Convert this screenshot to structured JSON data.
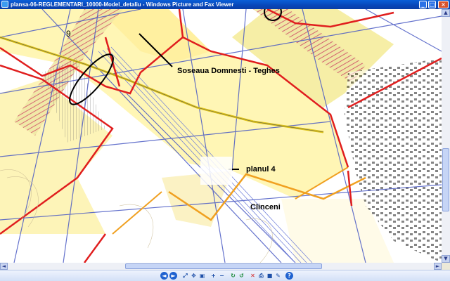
{
  "window": {
    "title": "plansa-06-REGLEMENTARI_10000-Model_detaliu - Windows Picture and Fax Viewer",
    "controls": {
      "minimize": "_",
      "maximize": "□",
      "close": "×"
    }
  },
  "map": {
    "labels": {
      "road": "Soseaua Domnesti - Teghes",
      "plan": "planul 4",
      "village": "Clinceni",
      "sheet_number": "9"
    },
    "colors": {
      "zone_fill": "#fff6b3",
      "boundary": "#e01e1e",
      "grid_lines": "#4a5ac4",
      "road": "#e0c51a"
    }
  },
  "toolbar": {
    "buttons": [
      {
        "name": "previous-image-button",
        "icon": "previous-icon",
        "glyph": "◄"
      },
      {
        "name": "next-image-button",
        "icon": "next-icon",
        "glyph": "►"
      },
      {
        "name": "best-fit-button",
        "icon": "best-fit-icon",
        "glyph": "⤢"
      },
      {
        "name": "actual-size-button",
        "icon": "actual-size-icon",
        "glyph": "✥"
      },
      {
        "name": "slideshow-button",
        "icon": "slideshow-icon",
        "glyph": "▣"
      },
      {
        "name": "zoom-in-button",
        "icon": "zoom-in-icon",
        "glyph": "+"
      },
      {
        "name": "zoom-out-button",
        "icon": "zoom-out-icon",
        "glyph": "−"
      },
      {
        "name": "rotate-clockwise-button",
        "icon": "rotate-cw-icon",
        "glyph": "↻"
      },
      {
        "name": "rotate-counterclockwise-button",
        "icon": "rotate-ccw-icon",
        "glyph": "↺"
      },
      {
        "name": "delete-button",
        "icon": "delete-icon",
        "glyph": "✕"
      },
      {
        "name": "print-button",
        "icon": "print-icon",
        "glyph": "⎙"
      },
      {
        "name": "save-button",
        "icon": "save-icon",
        "glyph": "■"
      },
      {
        "name": "open-for-editing-button",
        "icon": "edit-icon",
        "glyph": "✎"
      },
      {
        "name": "help-button",
        "icon": "help-icon",
        "glyph": "?"
      }
    ]
  }
}
